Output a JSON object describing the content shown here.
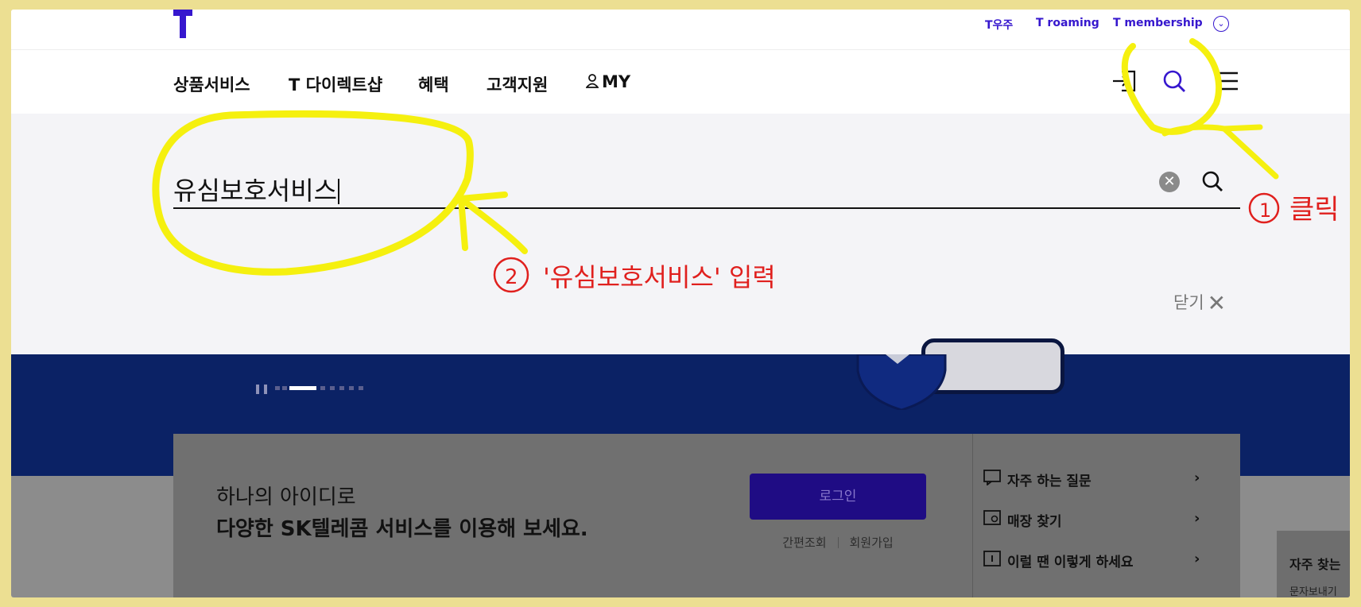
{
  "util": {
    "links": [
      "T우주",
      "T roaming",
      "T membership"
    ],
    "more_icon": "chevron-down-circle-icon",
    "brand_color": "#3617ce"
  },
  "gnb": {
    "items": [
      "상품서비스",
      "T 다이렉트샵",
      "혜택",
      "고객지원",
      "MY"
    ],
    "icons": [
      "login-icon",
      "search-icon",
      "menu-icon"
    ]
  },
  "search": {
    "value": "유심보호서비스",
    "clear_icon": "clear-icon",
    "submit_icon": "search-icon",
    "close_label": "닫기"
  },
  "hero": {
    "pager_total": 8,
    "pager_active": 3,
    "background": "#0b2265"
  },
  "login_card": {
    "line1": "하나의 아이디로",
    "line2": "다양한 SK텔레콤 서비스를 이용해 보세요.",
    "login_button": "로그인",
    "link_simple": "간편조회",
    "link_join": "회원가입",
    "side_items": [
      "자주 하는 질문",
      "매장 찾기",
      "이럴 땐 이렇게 하세요"
    ]
  },
  "floating": {
    "title": "자주 찾는",
    "subtitle": "문자보내기"
  },
  "annotations": {
    "step1_label": "클릭",
    "step2_label": "'유심보호서비스' 입력",
    "step1_number": "1",
    "step2_number": "2",
    "highlight_color": "#f5f00f",
    "annotation_color": "#e0201e"
  }
}
